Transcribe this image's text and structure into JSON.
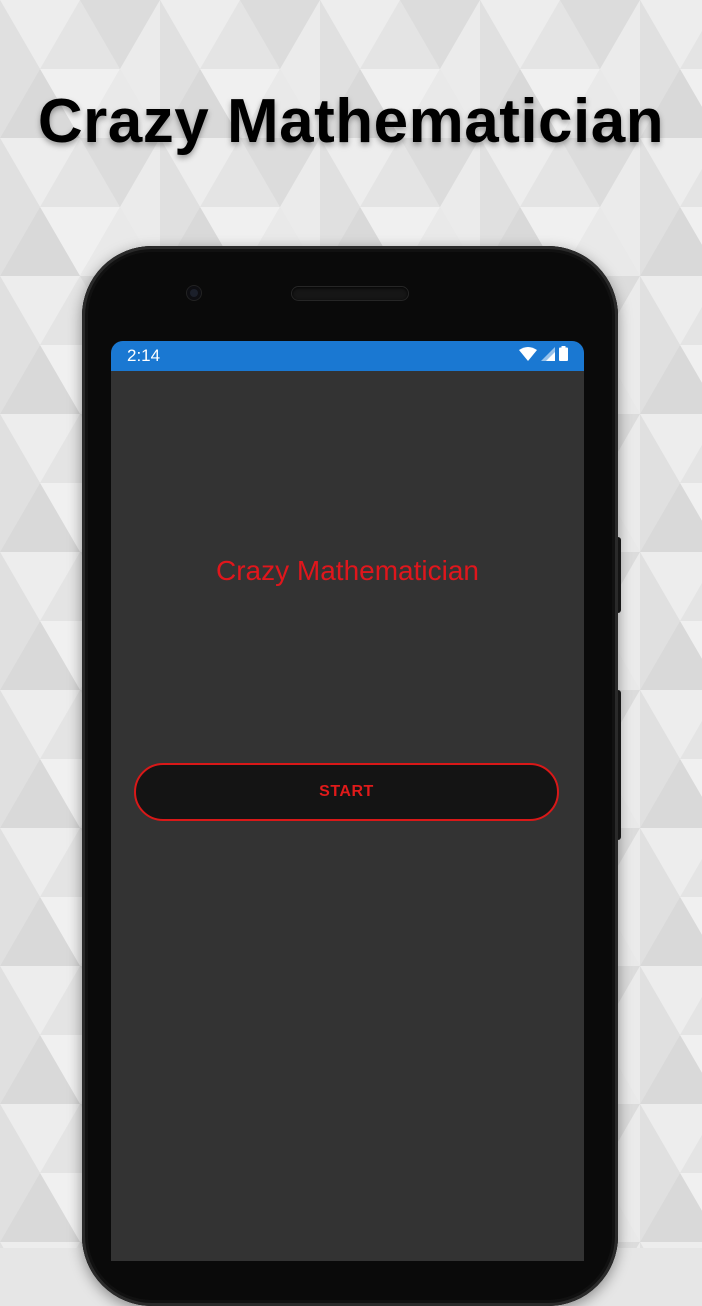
{
  "promo": {
    "headline": "Crazy Mathematician"
  },
  "device": {
    "status_bar": {
      "time": "2:14",
      "color": "#1a78d2",
      "icons": [
        "wifi-icon",
        "signal-icon",
        "battery-icon"
      ]
    }
  },
  "app": {
    "title": "Crazy Mathematician",
    "title_color": "#e0161c",
    "background_color": "#333333",
    "start_button_label": "START",
    "accent_color": "#d91818"
  }
}
